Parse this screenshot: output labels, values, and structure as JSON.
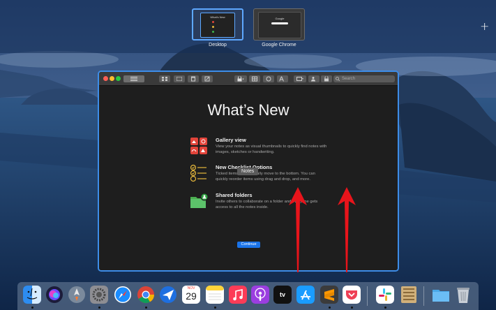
{
  "spaces": {
    "desktop_label": "Desktop",
    "chrome_label": "Google Chrome",
    "desktop_thumb_title": "What's New",
    "chrome_thumb_title": "Google",
    "add_icon": "+"
  },
  "window": {
    "search_placeholder": "Search",
    "headline": "What’s New",
    "features": [
      {
        "icon": "gallery-icon",
        "title": "Gallery view",
        "desc": "View your notes as visual thumbnails to quickly find notes with images, sketches or handwriting."
      },
      {
        "icon": "checklist-icon",
        "title": "New Checklist Options",
        "desc": "Ticked items automatically move to the bottom. You can quickly reorder items using drag and drop, and more."
      },
      {
        "icon": "shared-folder-icon",
        "title": "Shared folders",
        "desc": "Invite others to collaborate on a folder and everyone gets access to all the notes inside."
      }
    ],
    "tooltip": "Notes",
    "continue_label": "Continue"
  },
  "dock": {
    "calendar_month": "NOV",
    "calendar_day": "29",
    "tv_label": "tv",
    "apps": [
      "finder",
      "siri",
      "launchpad",
      "system-preferences",
      "safari",
      "chrome",
      "spark",
      "calendar",
      "notes",
      "music",
      "podcasts",
      "apple-tv",
      "app-store",
      "sublime-text",
      "pocket",
      "slack",
      "archive",
      "downloads",
      "trash"
    ]
  },
  "colors": {
    "accent": "#3d8de8",
    "arrow": "#e8141b",
    "window_bg": "#1e1e1e",
    "continue_bg": "#1a73e8"
  }
}
